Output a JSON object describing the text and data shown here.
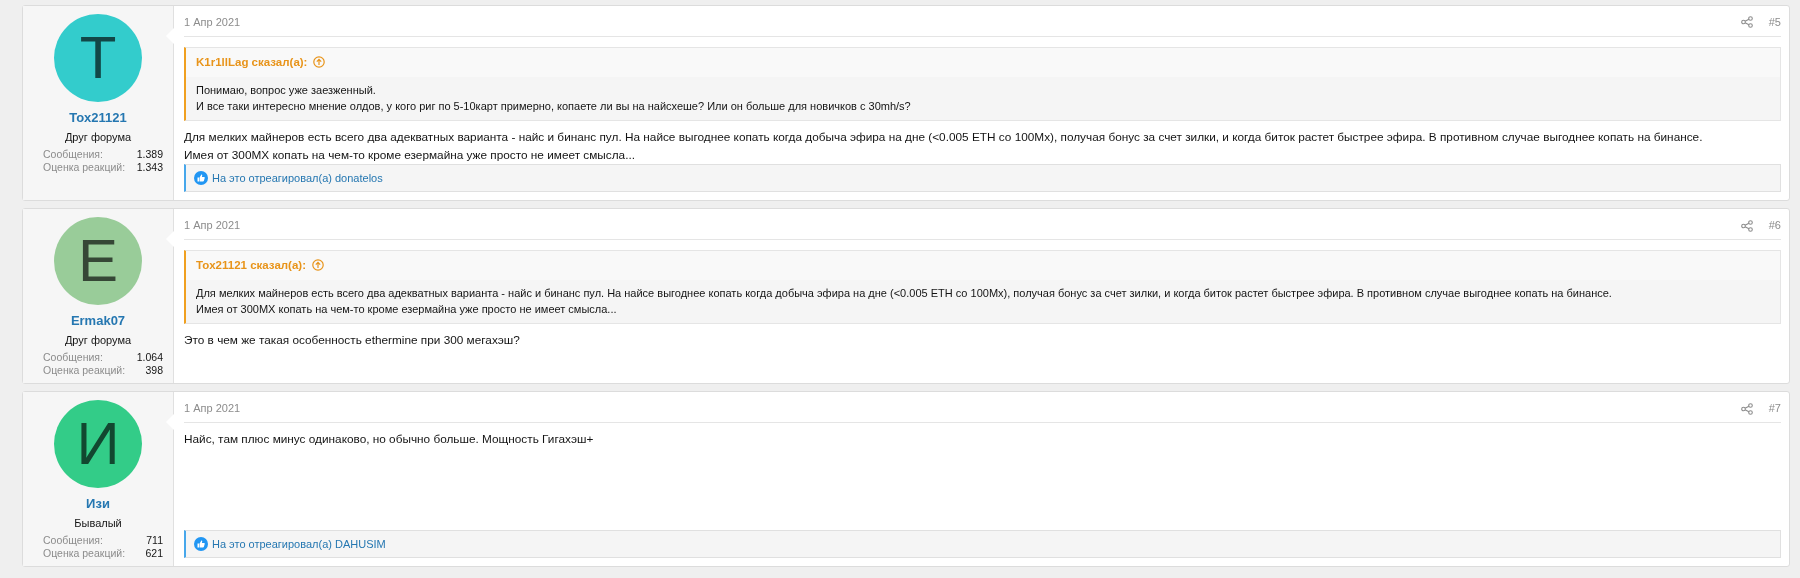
{
  "posts": [
    {
      "author": {
        "initial": "T",
        "name": "Tox21121",
        "title": "Друг форума",
        "color": "#33cccc",
        "stats": [
          {
            "label": "Сообщения:",
            "value": "1.389"
          },
          {
            "label": "Оценка реакций:",
            "value": "1.343"
          }
        ]
      },
      "date": "1 Апр 2021",
      "number": "#5",
      "quote": {
        "header": "K1r1llLag сказал(а):",
        "lines": [
          "Понимаю, вопрос уже заезженный.",
          "И все таки интересно мнение олдов, у кого риг по 5-10карт примерно, копаете ли вы на найсхеше? Или он больше для новичков с 30mh/s?"
        ]
      },
      "lines": [
        "Для мелких майнеров есть всего два адекватных варианта - найс и бинанс пул. На найсе выгоднее копать когда добыча эфира на дне (<0.005 ETH со 100Мх), получая бонус за счет зилки, и когда биток растет быстрее эфира. В противном случае выгоднее копать на бинансе.",
        "Имея от 300МХ копать на чем-то кроме езермайна уже просто не имеет смысла..."
      ],
      "reaction": "На это отреагировал(а) donatelos"
    },
    {
      "author": {
        "initial": "E",
        "name": "Ermak07",
        "title": "Друг форума",
        "color": "#99cc99",
        "stats": [
          {
            "label": "Сообщения:",
            "value": "1.064"
          },
          {
            "label": "Оценка реакций:",
            "value": "398"
          }
        ]
      },
      "date": "1 Апр 2021",
      "number": "#6",
      "quote": {
        "header": "Tox21121 сказал(а):",
        "lines": [
          "Для мелких майнеров есть всего два адекватных варианта - найс и бинанс пул. На найсе выгоднее копать когда добыча эфира на дне (<0.005 ETH со 100Мх), получая бонус за счет зилки, и когда биток растет быстрее эфира. В противном случае выгоднее копать на бинансе.",
          "Имея от 300МХ копать на чем-то кроме езермайна уже просто не имеет смысла..."
        ]
      },
      "lines": [
        "Это в чем же такая особенность ethermine при 300 мегахэш?"
      ]
    },
    {
      "author": {
        "initial": "И",
        "name": "Изи",
        "title": "Бывалый",
        "color": "#33cc88",
        "stats": [
          {
            "label": "Сообщения:",
            "value": "711"
          },
          {
            "label": "Оценка реакций:",
            "value": "621"
          }
        ]
      },
      "date": "1 Апр 2021",
      "number": "#7",
      "lines": [
        "Найс, там плюс минус одинаково, но обычно больше. Мощность Гигахэш+"
      ],
      "reaction": "На это отреагировал(а) DAHUSIM"
    }
  ]
}
